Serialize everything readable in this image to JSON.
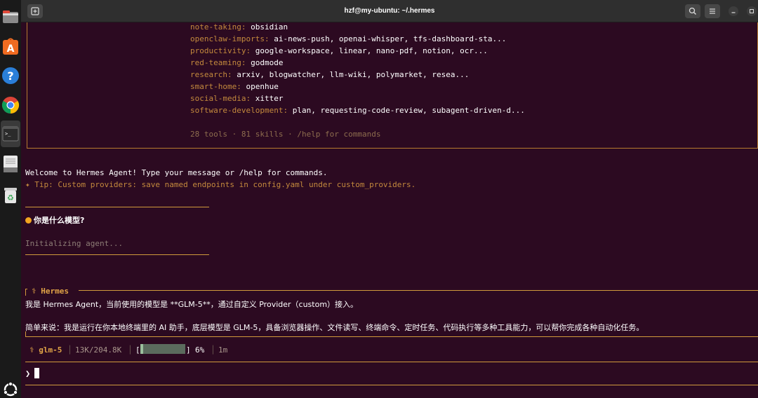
{
  "window": {
    "title": "hzf@my-ubuntu: ~/.hermes"
  },
  "dock": {
    "items": [
      "files-icon",
      "app-center-icon",
      "help-icon",
      "chrome-icon",
      "terminal-icon",
      "text-editor-icon",
      "trash-icon",
      "ubuntu-logo-icon"
    ]
  },
  "banner": {
    "categories": [
      {
        "name": "note-taking:",
        "value": "obsidian"
      },
      {
        "name": "openclaw-imports:",
        "value": "ai-news-push, openai-whisper, tfs-dashboard-sta..."
      },
      {
        "name": "productivity:",
        "value": "google-workspace, linear, nano-pdf, notion, ocr..."
      },
      {
        "name": "red-teaming:",
        "value": "godmode"
      },
      {
        "name": "research:",
        "value": "arxiv, blogwatcher, llm-wiki, polymarket, resea..."
      },
      {
        "name": "smart-home:",
        "value": "openhue"
      },
      {
        "name": "social-media:",
        "value": "xitter"
      },
      {
        "name": "software-development:",
        "value": "plan, requesting-code-review, subagent-driven-d..."
      }
    ],
    "summary": "28 tools · 81 skills · /help for commands"
  },
  "welcome": {
    "line": "Welcome to Hermes Agent! Type your message or /help for commands.",
    "tip": "✦ Tip: Custom providers: save named endpoints in config.yaml under custom_providers."
  },
  "user_message": {
    "text": "你是什么模型?",
    "status": "Initializing agent..."
  },
  "response": {
    "header": "⚕ Hermes",
    "line1": "我是 Hermes Agent，当前使用的模型是 **GLM-5**，通过自定义 Provider（custom）接入。",
    "line2": "简单来说：我是运行在你本地终端里的 AI 助手，底层模型是 GLM-5，具备浏览器操作、文件读写、终端命令、定时任务、代码执行等多种工具能力，可以帮你完成各种自动化任务。"
  },
  "status_bar": {
    "model": "⚕ glm-5",
    "tokens": "13K/204.8K",
    "bracket_open": "[",
    "bracket_close": "]",
    "percent": "6%",
    "usage_fraction": 0.06,
    "elapsed": "1m",
    "separator": "│"
  },
  "prompt": {
    "symbol": "❯"
  },
  "colors": {
    "accent": "#d19a3c",
    "category": "#c3893d",
    "background": "#2c0a21"
  }
}
